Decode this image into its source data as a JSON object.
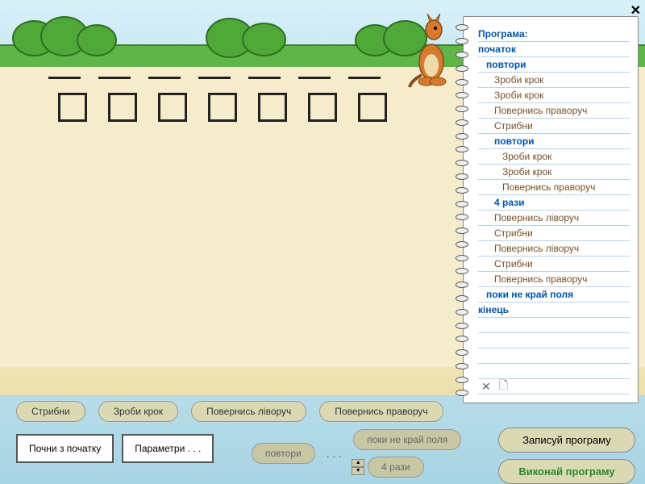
{
  "close_label": "✕",
  "program": {
    "title": "Програма:",
    "lines": [
      {
        "text": "початок",
        "cls": "kw",
        "indent": 0
      },
      {
        "text": "повтори",
        "cls": "kw",
        "indent": 1
      },
      {
        "text": "Зроби крок",
        "cls": "cmd",
        "indent": 2
      },
      {
        "text": "Зроби крок",
        "cls": "cmd",
        "indent": 2
      },
      {
        "text": "Повернись праворуч",
        "cls": "cmd",
        "indent": 2
      },
      {
        "text": "Стрибни",
        "cls": "cmd",
        "indent": 2
      },
      {
        "text": "повтори",
        "cls": "kw",
        "indent": 2
      },
      {
        "text": "Зроби крок",
        "cls": "cmd",
        "indent": 3
      },
      {
        "text": "Зроби крок",
        "cls": "cmd",
        "indent": 3
      },
      {
        "text": "Повернись праворуч",
        "cls": "cmd",
        "indent": 3
      },
      {
        "text": "4 рази",
        "cls": "kw",
        "indent": 2
      },
      {
        "text": "Повернись ліворуч",
        "cls": "cmd",
        "indent": 2
      },
      {
        "text": "Стрибни",
        "cls": "cmd",
        "indent": 2
      },
      {
        "text": "Повернись ліворуч",
        "cls": "cmd",
        "indent": 2
      },
      {
        "text": "Стрибни",
        "cls": "cmd",
        "indent": 2
      },
      {
        "text": "Повернись праворуч",
        "cls": "cmd",
        "indent": 2
      },
      {
        "text": "поки не край поля",
        "cls": "kw",
        "indent": 1
      },
      {
        "text": "кінець",
        "cls": "kw",
        "indent": 0
      }
    ]
  },
  "notebook_icons": {
    "delete": "✕",
    "new": "🗋"
  },
  "cmd_buttons": {
    "jump": "Стрибни",
    "step": "Зроби крок",
    "turn_left": "Повернись ліворуч",
    "turn_right": "Повернись праворуч"
  },
  "bottom": {
    "restart": "Почни з початку",
    "params": "Параметри . . .",
    "repeat": "повтори",
    "until_edge": "поки не край поля",
    "times": "4 рази",
    "dots": ". . ."
  },
  "right_buttons": {
    "record": "Записуй програму",
    "execute": "Виконай програму"
  }
}
